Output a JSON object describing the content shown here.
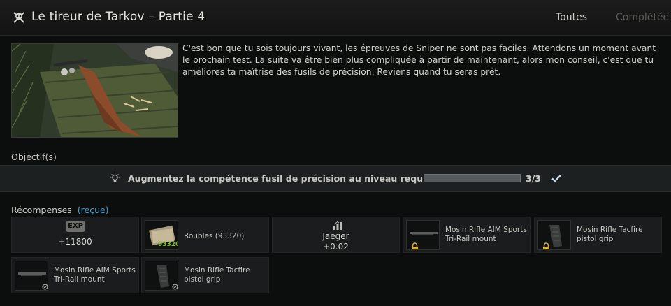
{
  "header": {
    "icon": "skull-crossbones-icon",
    "title": "Le tireur de Tarkov – Partie 4",
    "tabs": [
      {
        "label": "Toutes",
        "active": true
      },
      {
        "label": "Complétée",
        "active": false
      }
    ]
  },
  "quest": {
    "description": "C'est bon que tu sois toujours vivant, les épreuves de Sniper ne sont pas faciles. Attendons un moment avant le prochain test. La suite va être bien plus compliquée à partir de maintenant, alors mon conseil, c'est que tu améliores ta maîtrise des fusils de précision. Reviens quand tu seras prêt."
  },
  "objectives": {
    "label": "Objectif(s)",
    "items": [
      {
        "icon": "lightbulb-icon",
        "text": "Augmentez la compétence fusil de précision au niveau requis",
        "progress_fraction": 1.0,
        "count": "3/3",
        "completed": true
      }
    ]
  },
  "rewards": {
    "label": "Récompenses",
    "status": "(reçue)",
    "exp": {
      "badge": "EXP",
      "value": "+11800"
    },
    "money": {
      "label": "Roubles (93320)",
      "amount": "93320"
    },
    "trader": {
      "name": "Jaeger",
      "value": "+0.02"
    },
    "items": [
      {
        "label": "Mosin Rifle AIM Sports Tri-Rail mount",
        "icon": "lock-icon"
      },
      {
        "label": "Mosin Rifle Tacfire pistol grip",
        "icon": "lock-icon"
      },
      {
        "label": "Mosin Rifle AIM Sports Tri-Rail mount",
        "icon": "found-in-raid-icon"
      },
      {
        "label": "Mosin Rifle Tacfire pistol grip",
        "icon": "found-in-raid-icon"
      }
    ]
  },
  "colors": {
    "accent_link": "#4f9ed2",
    "checkmark": "#cfe3f2",
    "lock": "#d9b13b",
    "money": "#7fbf3a"
  }
}
